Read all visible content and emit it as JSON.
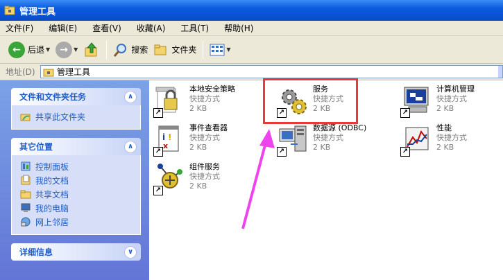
{
  "window": {
    "title": "管理工具"
  },
  "menu": [
    "文件(F)",
    "编辑(E)",
    "查看(V)",
    "收藏(A)",
    "工具(T)",
    "帮助(H)"
  ],
  "toolbar": {
    "back": "后退",
    "search": "搜索",
    "folders": "文件夹"
  },
  "address": {
    "label": "地址(D)",
    "value": "管理工具"
  },
  "tasks": {
    "file_tasks": {
      "title": "文件和文件夹任务",
      "items": [
        "共享此文件夹"
      ]
    },
    "other_places": {
      "title": "其它位置",
      "items": [
        "控制面板",
        "我的文档",
        "共享文档",
        "我的电脑",
        "网上邻居"
      ]
    },
    "details": {
      "title": "详细信息"
    }
  },
  "items": [
    {
      "name": "本地安全策略",
      "type": "快捷方式",
      "size": "2 KB",
      "icon": "local-security-policy-icon"
    },
    {
      "name": "服务",
      "type": "快捷方式",
      "size": "2 KB",
      "icon": "services-icon"
    },
    {
      "name": "计算机管理",
      "type": "快捷方式",
      "size": "2 KB",
      "icon": "computer-management-icon"
    },
    {
      "name": "事件查看器",
      "type": "快捷方式",
      "size": "2 KB",
      "icon": "event-viewer-icon"
    },
    {
      "name": "数据源 (ODBC)",
      "type": "快捷方式",
      "size": "2 KB",
      "icon": "odbc-data-source-icon"
    },
    {
      "name": "性能",
      "type": "快捷方式",
      "size": "2 KB",
      "icon": "performance-icon"
    },
    {
      "name": "组件服务",
      "type": "快捷方式",
      "size": "2 KB",
      "icon": "component-services-icon"
    }
  ],
  "colors": {
    "titlebar": "#0b5ae0",
    "task_pane": "#7ba2e7",
    "highlight_box": "#e83a3a",
    "pointer_arrow": "#ee44ee"
  }
}
